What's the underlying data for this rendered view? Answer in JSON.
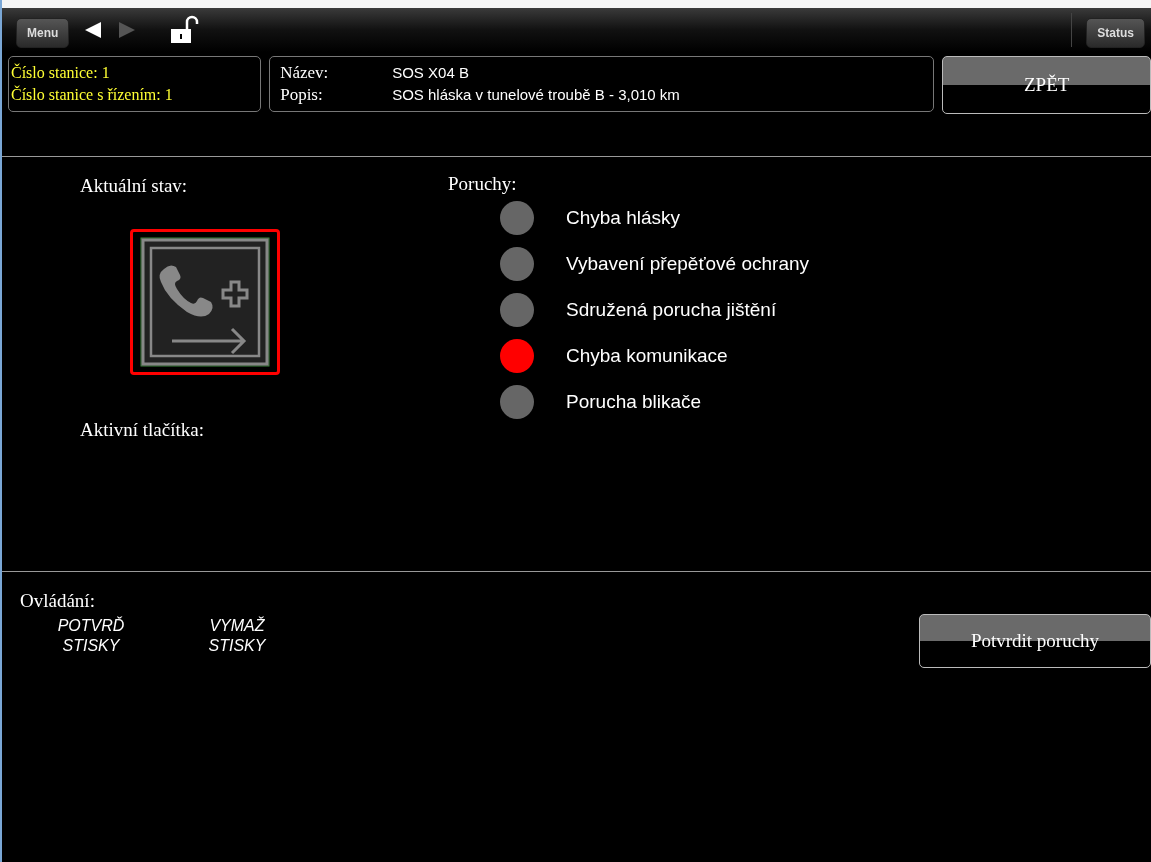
{
  "toolbar": {
    "menu_button": "Menu",
    "back_disabled": false,
    "forward_disabled": true,
    "status_button": "Status"
  },
  "station": {
    "number": "Číslo stanice: 1",
    "control_number": "Číslo stanice s řízením: 1"
  },
  "details": {
    "name_label": "Název:",
    "name": "SOS X04 B",
    "description_label": "Popis:",
    "description": "SOS hláska v tunelové troubě B - 3,010 km"
  },
  "back_button": "ZPĚT",
  "current_state": {
    "label": "Aktuální stav:",
    "alarm": true
  },
  "active_buttons": {
    "label": "Aktivní tlačítka:"
  },
  "faults": {
    "label": "Poruchy:",
    "items": [
      {
        "text": "Chyba hlásky",
        "active": false
      },
      {
        "text": "Vybavení přepěťové ochrany",
        "active": false
      },
      {
        "text": "Sdružená porucha jištění",
        "active": false
      },
      {
        "text": "Chyba komunikace",
        "active": true
      },
      {
        "text": "Porucha blikače",
        "active": false
      }
    ]
  },
  "controls": {
    "label": "Ovládání:",
    "buttons": [
      {
        "line1": "POTVRĎ",
        "line2": "STISKY"
      },
      {
        "line1": "VYMAŽ",
        "line2": "STISKY"
      }
    ]
  },
  "confirm_button": "Potvrdit poruchy"
}
